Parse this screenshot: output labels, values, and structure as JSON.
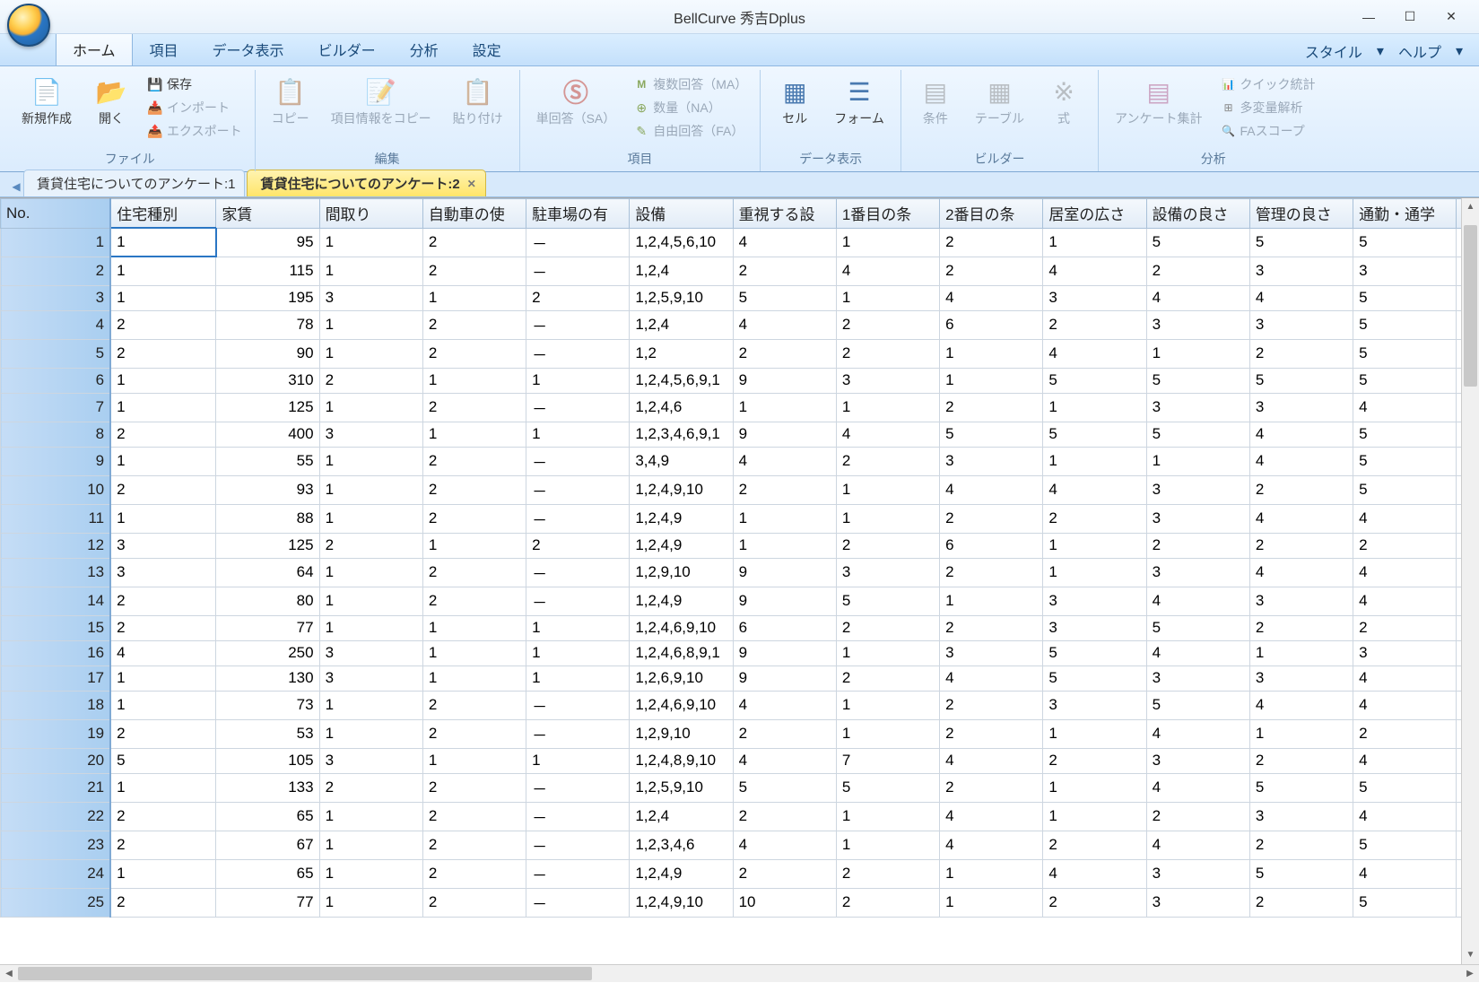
{
  "app": {
    "title": "BellCurve 秀吉Dplus"
  },
  "window": {
    "min": "—",
    "max": "☐",
    "close": "✕"
  },
  "menu": {
    "tabs": [
      "ホーム",
      "項目",
      "データ表示",
      "ビルダー",
      "分析",
      "設定"
    ],
    "active": 0,
    "right": {
      "style": "スタイル",
      "help": "ヘルプ"
    }
  },
  "ribbon": {
    "groups": [
      {
        "label": "ファイル",
        "large": [
          {
            "name": "new",
            "label": "新規作成"
          },
          {
            "name": "open",
            "label": "開く"
          }
        ],
        "small": [
          {
            "name": "save",
            "label": "保存"
          },
          {
            "name": "import",
            "label": "インポート",
            "dim": true
          },
          {
            "name": "export",
            "label": "エクスポート",
            "dim": true
          }
        ]
      },
      {
        "label": "編集",
        "large": [
          {
            "name": "copy",
            "label": "コピー",
            "dim": true
          },
          {
            "name": "iteminfo",
            "label": "項目情報をコピー",
            "dim": true
          },
          {
            "name": "paste",
            "label": "貼り付け",
            "dim": true
          }
        ]
      },
      {
        "label": "項目",
        "large": [
          {
            "name": "sa",
            "label": "単回答（SA）",
            "dim": true
          }
        ],
        "small": [
          {
            "name": "ma",
            "label": "複数回答（MA）",
            "dim": true
          },
          {
            "name": "na",
            "label": "数量（NA）",
            "dim": true
          },
          {
            "name": "fa",
            "label": "自由回答（FA）",
            "dim": true
          }
        ]
      },
      {
        "label": "データ表示",
        "large": [
          {
            "name": "cell",
            "label": "セル"
          },
          {
            "name": "form",
            "label": "フォーム"
          }
        ]
      },
      {
        "label": "ビルダー",
        "large": [
          {
            "name": "cond",
            "label": "条件",
            "dim": true
          },
          {
            "name": "table",
            "label": "テーブル",
            "dim": true
          },
          {
            "name": "formula",
            "label": "式",
            "dim": true
          }
        ]
      },
      {
        "label": "分析",
        "large": [
          {
            "name": "survey",
            "label": "アンケート集計",
            "dim": true
          }
        ],
        "small": [
          {
            "name": "qstat",
            "label": "クイック統計",
            "dim": true
          },
          {
            "name": "mva",
            "label": "多変量解析",
            "dim": true
          },
          {
            "name": "fascope",
            "label": "FAスコープ",
            "dim": true
          }
        ]
      }
    ]
  },
  "doctabs": {
    "items": [
      {
        "label": "賃貸住宅についてのアンケート:1",
        "active": false
      },
      {
        "label": "賃貸住宅についてのアンケート:2",
        "active": true
      }
    ]
  },
  "grid": {
    "headers": [
      "No.",
      "住宅種別",
      "家賃",
      "間取り",
      "自動車の使",
      "駐車場の有",
      "設備",
      "重視する設",
      "1番目の条",
      "2番目の条",
      "居室の広さ",
      "設備の良さ",
      "管理の良さ",
      "通勤・通学"
    ],
    "rows": [
      {
        "no": 1,
        "c": [
          "1",
          "95",
          "1",
          "2",
          "－",
          "1,2,4,5,6,10",
          "4",
          "1",
          "2",
          "1",
          "5",
          "5",
          "5"
        ]
      },
      {
        "no": 2,
        "c": [
          "1",
          "115",
          "1",
          "2",
          "－",
          "1,2,4",
          "2",
          "4",
          "2",
          "4",
          "2",
          "3",
          "3"
        ]
      },
      {
        "no": 3,
        "c": [
          "1",
          "195",
          "3",
          "1",
          "2",
          "1,2,5,9,10",
          "5",
          "1",
          "4",
          "3",
          "4",
          "4",
          "5"
        ]
      },
      {
        "no": 4,
        "c": [
          "2",
          "78",
          "1",
          "2",
          "－",
          "1,2,4",
          "4",
          "2",
          "6",
          "2",
          "3",
          "3",
          "5"
        ]
      },
      {
        "no": 5,
        "c": [
          "2",
          "90",
          "1",
          "2",
          "－",
          "1,2",
          "2",
          "2",
          "1",
          "4",
          "1",
          "2",
          "5"
        ]
      },
      {
        "no": 6,
        "c": [
          "1",
          "310",
          "2",
          "1",
          "1",
          "1,2,4,5,6,9,1",
          "9",
          "3",
          "1",
          "5",
          "5",
          "5",
          "5"
        ]
      },
      {
        "no": 7,
        "c": [
          "1",
          "125",
          "1",
          "2",
          "－",
          "1,2,4,6",
          "1",
          "1",
          "2",
          "1",
          "3",
          "3",
          "4"
        ]
      },
      {
        "no": 8,
        "c": [
          "2",
          "400",
          "3",
          "1",
          "1",
          "1,2,3,4,6,9,1",
          "9",
          "4",
          "5",
          "5",
          "5",
          "4",
          "5"
        ]
      },
      {
        "no": 9,
        "c": [
          "1",
          "55",
          "1",
          "2",
          "－",
          "3,4,9",
          "4",
          "2",
          "3",
          "1",
          "1",
          "4",
          "5"
        ]
      },
      {
        "no": 10,
        "c": [
          "2",
          "93",
          "1",
          "2",
          "－",
          "1,2,4,9,10",
          "2",
          "1",
          "4",
          "4",
          "3",
          "2",
          "5"
        ]
      },
      {
        "no": 11,
        "c": [
          "1",
          "88",
          "1",
          "2",
          "－",
          "1,2,4,9",
          "1",
          "1",
          "2",
          "2",
          "3",
          "4",
          "4"
        ]
      },
      {
        "no": 12,
        "c": [
          "3",
          "125",
          "2",
          "1",
          "2",
          "1,2,4,9",
          "1",
          "2",
          "6",
          "1",
          "2",
          "2",
          "2"
        ]
      },
      {
        "no": 13,
        "c": [
          "3",
          "64",
          "1",
          "2",
          "－",
          "1,2,9,10",
          "9",
          "3",
          "2",
          "1",
          "3",
          "4",
          "4"
        ]
      },
      {
        "no": 14,
        "c": [
          "2",
          "80",
          "1",
          "2",
          "－",
          "1,2,4,9",
          "9",
          "5",
          "1",
          "3",
          "4",
          "3",
          "4"
        ]
      },
      {
        "no": 15,
        "c": [
          "2",
          "77",
          "1",
          "1",
          "1",
          "1,2,4,6,9,10",
          "6",
          "2",
          "2",
          "3",
          "5",
          "2",
          "2"
        ]
      },
      {
        "no": 16,
        "c": [
          "4",
          "250",
          "3",
          "1",
          "1",
          "1,2,4,6,8,9,1",
          "9",
          "1",
          "3",
          "5",
          "4",
          "1",
          "3"
        ]
      },
      {
        "no": 17,
        "c": [
          "1",
          "130",
          "3",
          "1",
          "1",
          "1,2,6,9,10",
          "9",
          "2",
          "4",
          "5",
          "3",
          "3",
          "4"
        ]
      },
      {
        "no": 18,
        "c": [
          "1",
          "73",
          "1",
          "2",
          "－",
          "1,2,4,6,9,10",
          "4",
          "1",
          "2",
          "3",
          "5",
          "4",
          "4"
        ]
      },
      {
        "no": 19,
        "c": [
          "2",
          "53",
          "1",
          "2",
          "－",
          "1,2,9,10",
          "2",
          "1",
          "2",
          "1",
          "4",
          "1",
          "2"
        ]
      },
      {
        "no": 20,
        "c": [
          "5",
          "105",
          "3",
          "1",
          "1",
          "1,2,4,8,9,10",
          "4",
          "7",
          "4",
          "2",
          "3",
          "2",
          "4"
        ]
      },
      {
        "no": 21,
        "c": [
          "1",
          "133",
          "2",
          "2",
          "－",
          "1,2,5,9,10",
          "5",
          "5",
          "2",
          "1",
          "4",
          "5",
          "5"
        ]
      },
      {
        "no": 22,
        "c": [
          "2",
          "65",
          "1",
          "2",
          "－",
          "1,2,4",
          "2",
          "1",
          "4",
          "1",
          "2",
          "3",
          "4"
        ]
      },
      {
        "no": 23,
        "c": [
          "2",
          "67",
          "1",
          "2",
          "－",
          "1,2,3,4,6",
          "4",
          "1",
          "4",
          "2",
          "4",
          "2",
          "5"
        ]
      },
      {
        "no": 24,
        "c": [
          "1",
          "65",
          "1",
          "2",
          "－",
          "1,2,4,9",
          "2",
          "2",
          "1",
          "4",
          "3",
          "5",
          "4"
        ]
      },
      {
        "no": 25,
        "c": [
          "2",
          "77",
          "1",
          "2",
          "－",
          "1,2,4,9,10",
          "10",
          "2",
          "1",
          "2",
          "3",
          "2",
          "5"
        ]
      }
    ],
    "selected": {
      "row": 0,
      "col": 0
    }
  }
}
